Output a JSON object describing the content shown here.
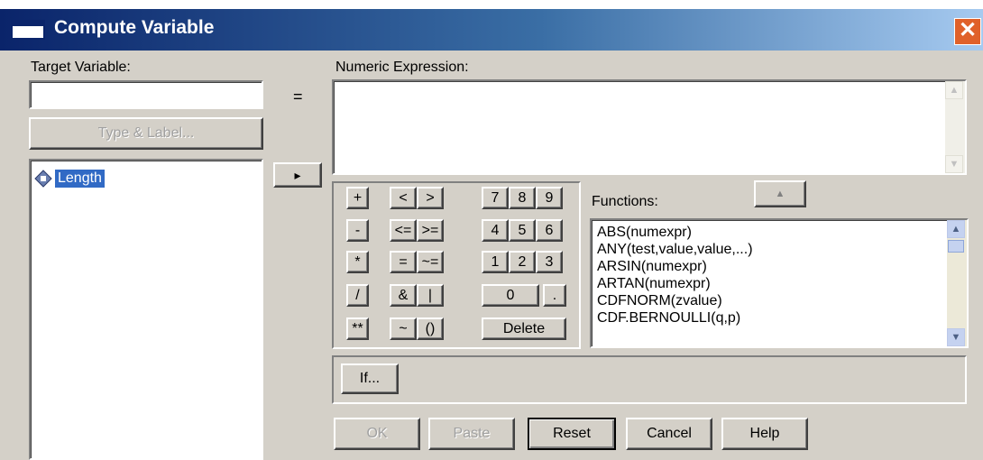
{
  "window": {
    "title": "Compute Variable",
    "close_glyph": "✕"
  },
  "target": {
    "label": "Target Variable:",
    "value": "",
    "equals": "="
  },
  "type_label_button": "Type & Label...",
  "variables": [
    "Length"
  ],
  "expression": {
    "label": "Numeric Expression:",
    "value": ""
  },
  "move_arrow": "▸",
  "keypad": {
    "plus": "+",
    "lt": "<",
    "gt": ">",
    "k7": "7",
    "k8": "8",
    "k9": "9",
    "minus": "-",
    "le": "<=",
    "ge": ">=",
    "k4": "4",
    "k5": "5",
    "k6": "6",
    "times": "*",
    "eq": "=",
    "ne": "~=",
    "k1": "1",
    "k2": "2",
    "k3": "3",
    "div": "/",
    "and": "&",
    "or": "|",
    "k0": "0",
    "dot": ".",
    "pow": "**",
    "not": "~",
    "paren": "()",
    "delete": "Delete"
  },
  "functions": {
    "label": "Functions:",
    "up_glyph": "▲",
    "items": [
      "ABS(numexpr)",
      "ANY(test,value,value,...)",
      "ARSIN(numexpr)",
      "ARTAN(numexpr)",
      "CDFNORM(zvalue)",
      "CDF.BERNOULLI(q,p)"
    ]
  },
  "if_button": "If...",
  "buttons": {
    "ok": "OK",
    "paste": "Paste",
    "reset": "Reset",
    "cancel": "Cancel",
    "help": "Help"
  }
}
